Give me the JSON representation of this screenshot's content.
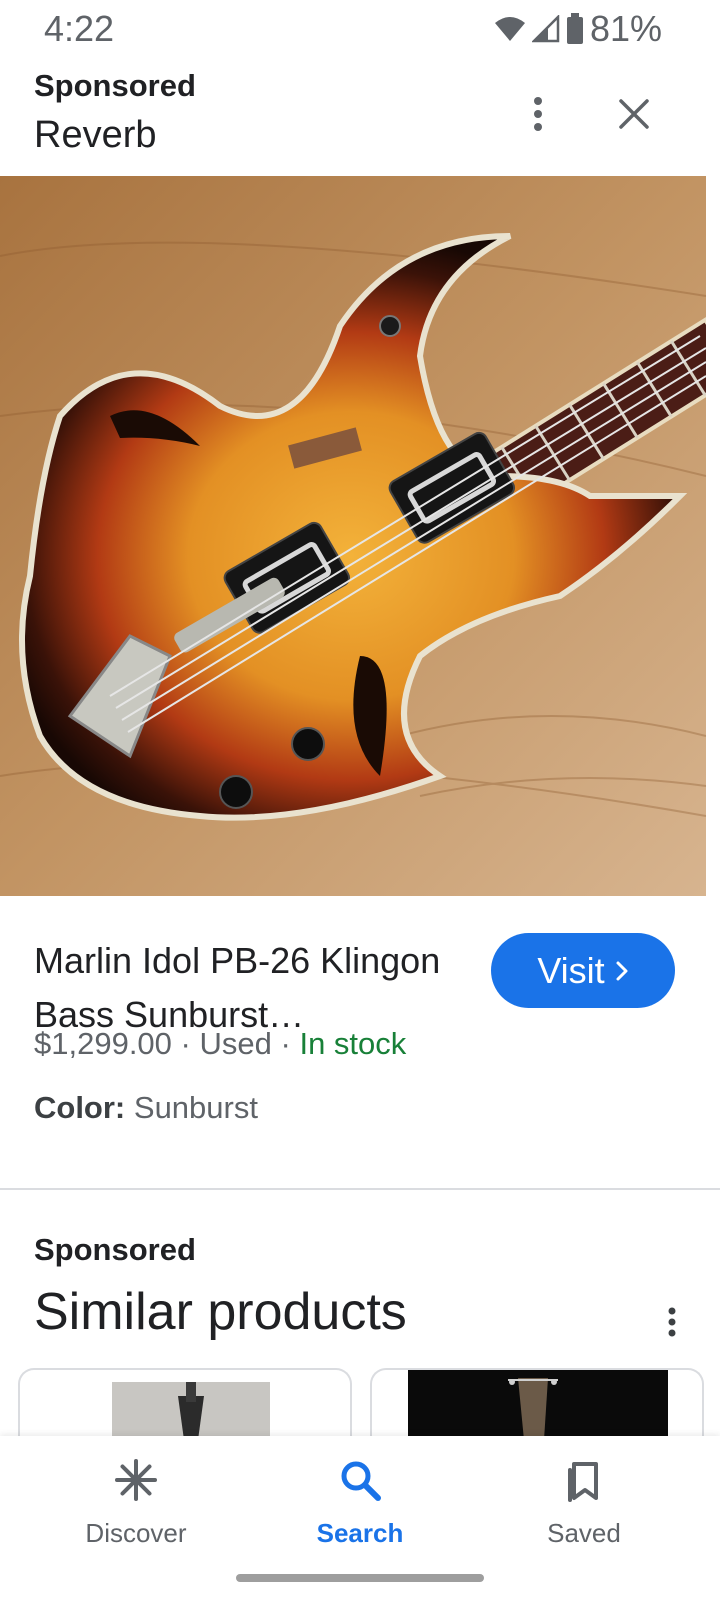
{
  "status_bar": {
    "time": "4:22",
    "battery_percent": "81%",
    "icons": [
      "wifi-icon",
      "cell-signal-icon",
      "battery-icon"
    ]
  },
  "ad_header": {
    "sponsored_label": "Sponsored",
    "advertiser": "Reverb",
    "icons": [
      "more-vert-icon",
      "close-icon"
    ]
  },
  "product": {
    "image_subject": "sunburst hollow-body bass guitar on wood floor",
    "title": "Marlin Idol PB-26 Klingon Bass Sunburst…",
    "price": "$1,299.00",
    "separator": "·",
    "condition": "Used",
    "availability": "In stock",
    "color_label": "Color:",
    "color_value": "Sunburst",
    "visit_label": "Visit",
    "visit_icon": "chevron-right-icon"
  },
  "similar": {
    "sponsored_label": "Sponsored",
    "title": "Similar products",
    "more_icon": "more-vert-icon"
  },
  "bottom_nav": {
    "items": [
      {
        "label": "Discover",
        "icon": "discover-asterisk-icon",
        "active": false
      },
      {
        "label": "Search",
        "icon": "search-icon",
        "active": true
      },
      {
        "label": "Saved",
        "icon": "saved-bookmark-icon",
        "active": false
      }
    ]
  },
  "colors": {
    "accent": "#1a73e8",
    "in_stock": "#188038",
    "text_primary": "#202124",
    "text_secondary": "#5f6368",
    "divider": "#dadce0"
  }
}
